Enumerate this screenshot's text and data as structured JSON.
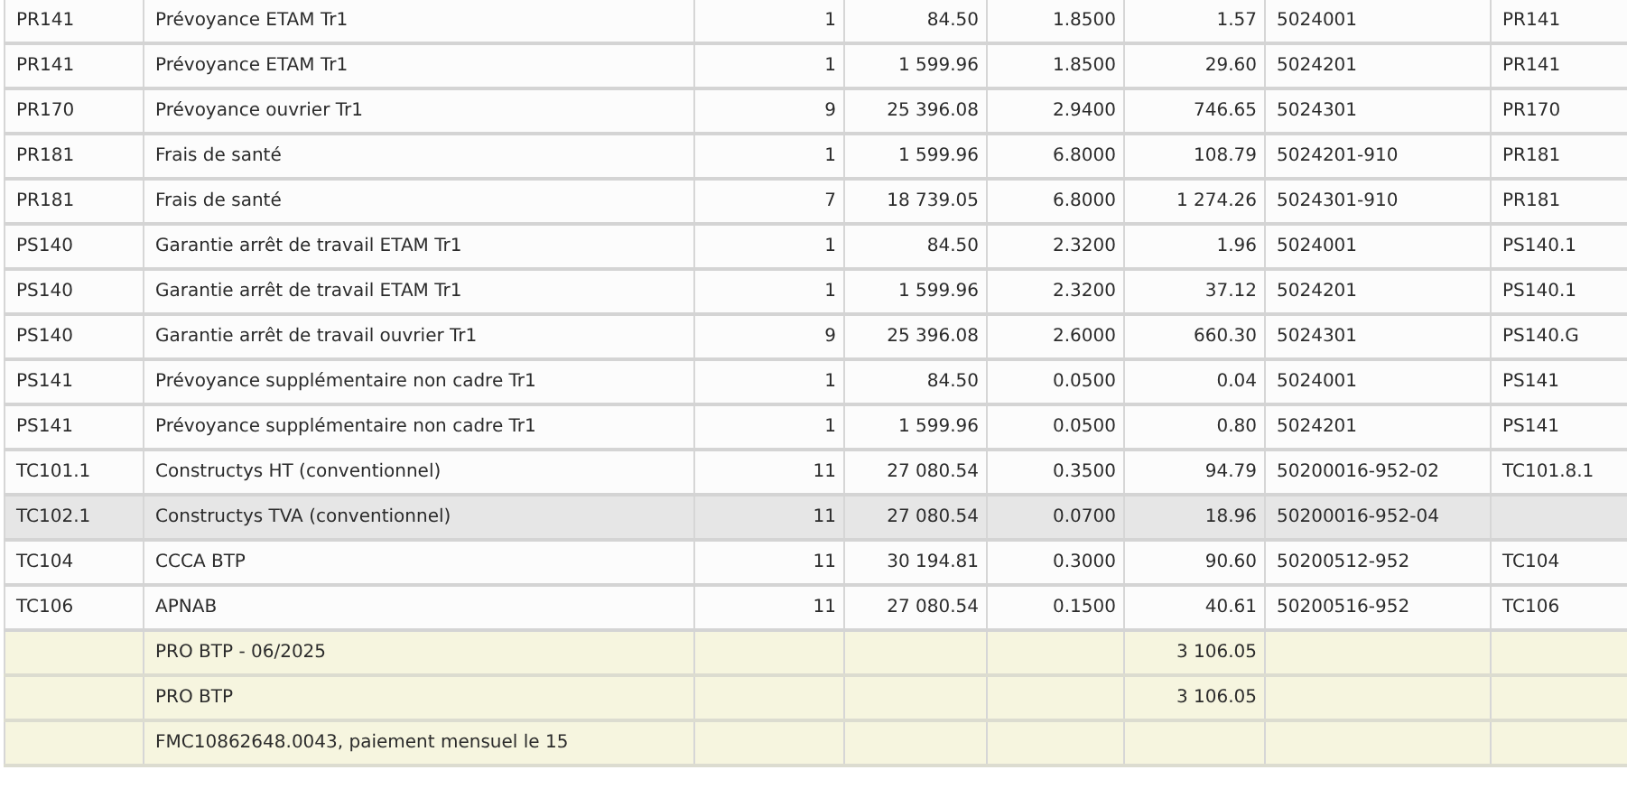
{
  "table": {
    "rows": [
      {
        "kind": "line",
        "selected": false,
        "column_1": "PR141",
        "column_2": "Prévoyance ETAM Tr1",
        "column_3": "1",
        "column_4": "84.50",
        "column_5": "1.8500",
        "column_6": "1.57",
        "column_7": "5024001",
        "column_8": "PR141"
      },
      {
        "kind": "line",
        "selected": false,
        "column_1": "PR141",
        "column_2": "Prévoyance ETAM Tr1",
        "column_3": "1",
        "column_4": "1 599.96",
        "column_5": "1.8500",
        "column_6": "29.60",
        "column_7": "5024201",
        "column_8": "PR141"
      },
      {
        "kind": "line",
        "selected": false,
        "column_1": "PR170",
        "column_2": "Prévoyance ouvrier Tr1",
        "column_3": "9",
        "column_4": "25 396.08",
        "column_5": "2.9400",
        "column_6": "746.65",
        "column_7": "5024301",
        "column_8": "PR170"
      },
      {
        "kind": "line",
        "selected": false,
        "column_1": "PR181",
        "column_2": "Frais de santé",
        "column_3": "1",
        "column_4": "1 599.96",
        "column_5": "6.8000",
        "column_6": "108.79",
        "column_7": "5024201-910",
        "column_8": "PR181"
      },
      {
        "kind": "line",
        "selected": false,
        "column_1": "PR181",
        "column_2": "Frais de santé",
        "column_3": "7",
        "column_4": "18 739.05",
        "column_5": "6.8000",
        "column_6": "1 274.26",
        "column_7": "5024301-910",
        "column_8": "PR181"
      },
      {
        "kind": "line",
        "selected": false,
        "column_1": "PS140",
        "column_2": "Garantie arrêt de travail ETAM Tr1",
        "column_3": "1",
        "column_4": "84.50",
        "column_5": "2.3200",
        "column_6": "1.96",
        "column_7": "5024001",
        "column_8": "PS140.1"
      },
      {
        "kind": "line",
        "selected": false,
        "column_1": "PS140",
        "column_2": "Garantie arrêt de travail ETAM Tr1",
        "column_3": "1",
        "column_4": "1 599.96",
        "column_5": "2.3200",
        "column_6": "37.12",
        "column_7": "5024201",
        "column_8": "PS140.1"
      },
      {
        "kind": "line",
        "selected": false,
        "column_1": "PS140",
        "column_2": "Garantie arrêt de travail ouvrier Tr1",
        "column_3": "9",
        "column_4": "25 396.08",
        "column_5": "2.6000",
        "column_6": "660.30",
        "column_7": "5024301",
        "column_8": "PS140.G"
      },
      {
        "kind": "line",
        "selected": false,
        "column_1": "PS141",
        "column_2": "Prévoyance supplémentaire non cadre Tr1",
        "column_3": "1",
        "column_4": "84.50",
        "column_5": "0.0500",
        "column_6": "0.04",
        "column_7": "5024001",
        "column_8": "PS141"
      },
      {
        "kind": "line",
        "selected": false,
        "column_1": "PS141",
        "column_2": "Prévoyance supplémentaire non cadre Tr1",
        "column_3": "1",
        "column_4": "1 599.96",
        "column_5": "0.0500",
        "column_6": "0.80",
        "column_7": "5024201",
        "column_8": "PS141"
      },
      {
        "kind": "line",
        "selected": false,
        "column_1": "TC101.1",
        "column_2": "Constructys HT (conventionnel)",
        "column_3": "11",
        "column_4": "27 080.54",
        "column_5": "0.3500",
        "column_6": "94.79",
        "column_7": "50200016-952-02",
        "column_8": "TC101.8.1"
      },
      {
        "kind": "line",
        "selected": true,
        "column_1": "TC102.1",
        "column_2": "Constructys TVA (conventionnel)",
        "column_3": "11",
        "column_4": "27 080.54",
        "column_5": "0.0700",
        "column_6": "18.96",
        "column_7": "50200016-952-04"
      },
      {
        "kind": "line",
        "selected": false,
        "column_1": "TC104",
        "column_2": "CCCA BTP",
        "column_3": "11",
        "column_4": "30 194.81",
        "column_5": "0.3000",
        "column_6": "90.60",
        "column_7": "50200512-952",
        "column_8": "TC104"
      },
      {
        "kind": "line",
        "selected": false,
        "column_1": "TC106",
        "column_2": "APNAB",
        "column_3": "11",
        "column_4": "27 080.54",
        "column_5": "0.1500",
        "column_6": "40.61",
        "column_7": "50200516-952",
        "column_8": "TC106"
      },
      {
        "kind": "total",
        "selected": false,
        "column_2": "PRO BTP - 06/2025",
        "column_6": "3 106.05"
      },
      {
        "kind": "total",
        "selected": false,
        "column_2": "PRO BTP",
        "column_6": "3 106.05"
      },
      {
        "kind": "total",
        "selected": false,
        "column_2": "FMC10862648.0043, paiement mensuel le 15"
      }
    ]
  }
}
